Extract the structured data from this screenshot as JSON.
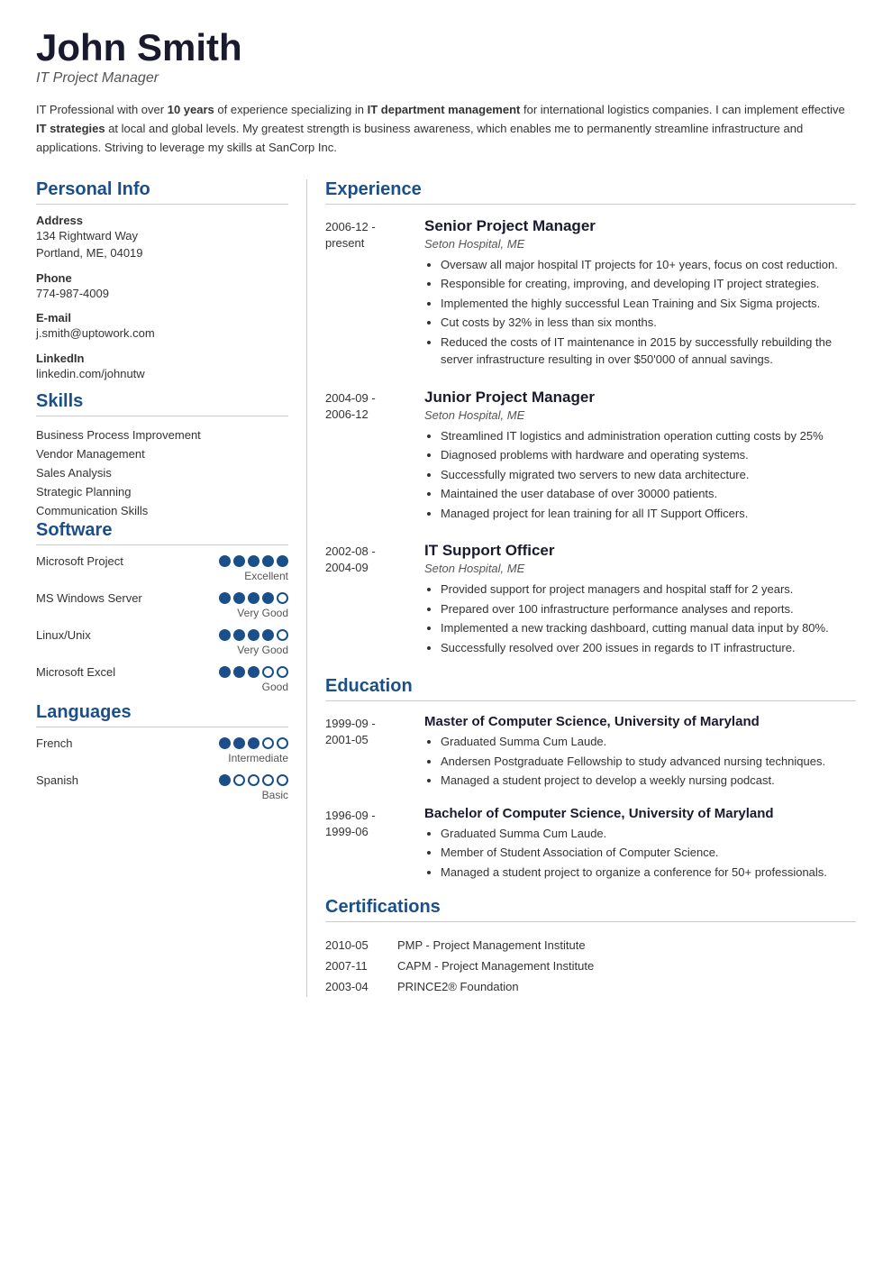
{
  "header": {
    "name": "John Smith",
    "title": "IT Project Manager"
  },
  "summary": {
    "text_parts": [
      "IT Professional with over ",
      "10 years",
      " of experience specializing in ",
      "IT department management",
      " for international logistics companies. I can implement effective ",
      "IT strategies",
      " at local and global levels. My greatest strength is business awareness, which enables me to permanently streamline infrastructure and applications. Striving to leverage my skills at SanCorp Inc."
    ]
  },
  "personal_info": {
    "section_title": "Personal Info",
    "items": [
      {
        "label": "Address",
        "value": "134 Rightward Way\nPortland, ME, 04019"
      },
      {
        "label": "Phone",
        "value": "774-987-4009"
      },
      {
        "label": "E-mail",
        "value": "j.smith@uptowork.com"
      },
      {
        "label": "LinkedIn",
        "value": "linkedin.com/johnutw"
      }
    ]
  },
  "skills": {
    "section_title": "Skills",
    "items": [
      "Business Process Improvement",
      "Vendor Management",
      "Sales Analysis",
      "Strategic Planning",
      "Communication Skills"
    ]
  },
  "software": {
    "section_title": "Software",
    "items": [
      {
        "name": "Microsoft Project",
        "filled": 5,
        "total": 5,
        "rating": "Excellent"
      },
      {
        "name": "MS Windows Server",
        "filled": 4,
        "total": 5,
        "rating": "Very Good"
      },
      {
        "name": "Linux/Unix",
        "filled": 4,
        "total": 5,
        "rating": "Very Good"
      },
      {
        "name": "Microsoft Excel",
        "filled": 3,
        "total": 5,
        "rating": "Good"
      }
    ]
  },
  "languages": {
    "section_title": "Languages",
    "items": [
      {
        "name": "French",
        "filled": 3,
        "total": 5,
        "rating": "Intermediate"
      },
      {
        "name": "Spanish",
        "filled": 1,
        "total": 5,
        "rating": "Basic"
      }
    ]
  },
  "experience": {
    "section_title": "Experience",
    "entries": [
      {
        "date": "2006-12 -\npresent",
        "title": "Senior Project Manager",
        "company": "Seton Hospital, ME",
        "bullets": [
          "Oversaw all major hospital IT projects for 10+ years, focus on cost reduction.",
          "Responsible for creating, improving, and developing IT project strategies.",
          "Implemented the highly successful Lean Training and Six Sigma projects.",
          "Cut costs by 32% in less than six months.",
          "Reduced the costs of IT maintenance in 2015 by successfully rebuilding the server infrastructure resulting in over $50'000 of annual savings."
        ]
      },
      {
        "date": "2004-09 -\n2006-12",
        "title": "Junior Project Manager",
        "company": "Seton Hospital, ME",
        "bullets": [
          "Streamlined IT logistics and administration operation cutting costs by 25%",
          "Diagnosed problems with hardware and operating systems.",
          "Successfully migrated two servers to new data architecture.",
          "Maintained the user database of over 30000 patients.",
          "Managed project for lean training for all IT Support Officers."
        ]
      },
      {
        "date": "2002-08 -\n2004-09",
        "title": "IT Support Officer",
        "company": "Seton Hospital, ME",
        "bullets": [
          "Provided support for project managers and hospital staff for 2 years.",
          "Prepared over 100 infrastructure performance analyses and reports.",
          "Implemented a new tracking dashboard, cutting manual data input by 80%.",
          "Successfully resolved over 200 issues in regards to IT infrastructure."
        ]
      }
    ]
  },
  "education": {
    "section_title": "Education",
    "entries": [
      {
        "date": "1999-09 -\n2001-05",
        "title": "Master of Computer Science, University of Maryland",
        "bullets": [
          "Graduated Summa Cum Laude.",
          "Andersen Postgraduate Fellowship to study advanced nursing techniques.",
          "Managed a student project to develop a weekly nursing podcast."
        ]
      },
      {
        "date": "1996-09 -\n1999-06",
        "title": "Bachelor of Computer Science, University of Maryland",
        "bullets": [
          "Graduated Summa Cum Laude.",
          "Member of Student Association of Computer Science.",
          "Managed a student project to organize a conference for 50+ professionals."
        ]
      }
    ]
  },
  "certifications": {
    "section_title": "Certifications",
    "items": [
      {
        "date": "2010-05",
        "name": "PMP - Project Management Institute"
      },
      {
        "date": "2007-11",
        "name": "CAPM - Project Management Institute"
      },
      {
        "date": "2003-04",
        "name": "PRINCE2® Foundation"
      }
    ]
  },
  "colors": {
    "accent": "#1a4f8a",
    "dark": "#1a1a2e"
  }
}
